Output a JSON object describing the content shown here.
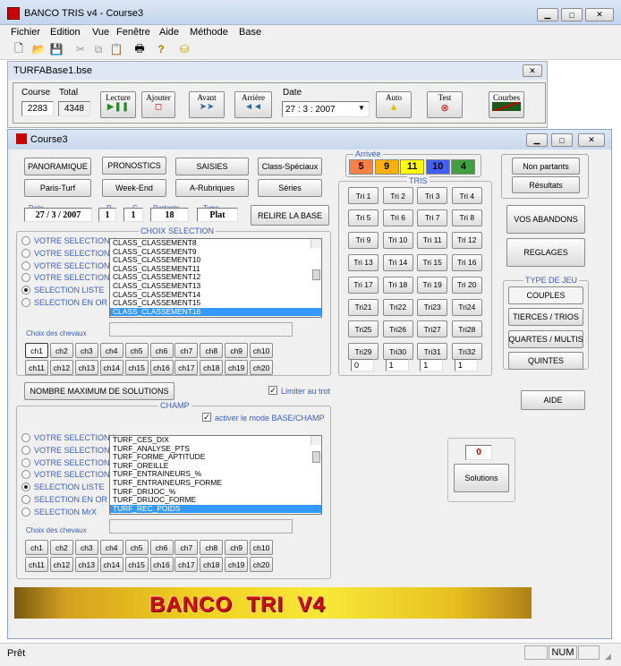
{
  "app": {
    "title": "BANCO TRIS v4 - Course3",
    "icon": "turf-icon"
  },
  "menu": [
    "Fichier",
    "Edition",
    "Vue",
    "Fenêtre",
    "Aide",
    "Méthode",
    "Base"
  ],
  "base_window": {
    "title": "TURFABase1.bse",
    "course_label": "Course",
    "course_value": "2283",
    "total_label": "Total",
    "total_value": "4348",
    "lecture": "Lecture",
    "ajouter": "Ajouter",
    "avant": "Avant",
    "arriere": "Arrière",
    "date_label": "Date",
    "date_value": "27 : 3 : 2007",
    "auto": "Auto",
    "test": "Test",
    "courbes": "Courbes"
  },
  "course_window": {
    "title": "Course3"
  },
  "nav_buttons": [
    "PANORAMIQUE",
    "PRONOSTICS",
    "SAISIES",
    "Class-Spéciaux",
    "Paris-Turf",
    "Week-End",
    "A-Rubriques",
    "Séries"
  ],
  "info": {
    "date_label": "Date",
    "date_value": "27 / 3 / 2007",
    "r_label": "R",
    "r_value": "1",
    "c_label": "C",
    "c_value": "1",
    "partants_label": "Partants",
    "partants_value": "18",
    "type_label": "Type",
    "type_value": "Plat",
    "relire": "RELIRE LA BASE"
  },
  "choix_selection": {
    "title": "CHOIX SELECTION",
    "options": [
      "VOTRE SELECTION 1",
      "VOTRE SELECTION 2",
      "VOTRE SELECTION 3",
      "VOTRE SELECTION 4",
      "SELECTION LISTE",
      "SELECTION EN OR"
    ],
    "selected_index": 4,
    "list": [
      "CLASS_CLASSEMENT8",
      "CLASS_CLASSEMENT9",
      "CLASS_CLASSEMENT10",
      "CLASS_CLASSEMENT11",
      "CLASS_CLASSEMENT12",
      "CLASS_CLASSEMENT13",
      "CLASS_CLASSEMENT14",
      "CLASS_CLASSEMENT15",
      "CLASS_CLASSEMENT16"
    ],
    "list_selected": 8,
    "choix_chevaux": "Choix des chevaux"
  },
  "horses": [
    "ch1",
    "ch2",
    "ch3",
    "ch4",
    "ch5",
    "ch6",
    "ch7",
    "ch8",
    "ch9",
    "ch10",
    "ch11",
    "ch12",
    "ch13",
    "ch14",
    "ch15",
    "ch16",
    "ch17",
    "ch18",
    "ch19",
    "ch20"
  ],
  "nombre_max": "NOMBRE MAXIMUM DE SOLUTIONS",
  "limiter": "Limiter au trot",
  "champ": {
    "title": "CHAMP",
    "activer": "activer le mode  BASE/CHAMP",
    "options": [
      "VOTRE SELECTION 1",
      "VOTRE SELECTION 2",
      "VOTRE SELECTION 3",
      "VOTRE SELECTION 4",
      "SELECTION LISTE",
      "SELECTION EN OR",
      "SELECTION MrX"
    ],
    "selected_index": 4,
    "list": [
      "TURF_CES_DIX",
      "TURF_ANALYSE_PTS",
      "TURF_FORME_APTITUDE",
      "TURF_OREILLE",
      "TURF_ENTRAINEURS_%",
      "TURF_ENTRAINEURS_FORME",
      "TURF_DRIJOC_%",
      "TURF_DRIJOC_FORME",
      "TURF_REC_POIDS"
    ],
    "list_selected": 8,
    "choix_chevaux": "Choix des chevaux"
  },
  "arrivee": {
    "title": "Arrivée",
    "values": [
      "5",
      "9",
      "11",
      "10",
      "4"
    ],
    "colors": [
      "#ff8040",
      "#ffb000",
      "#ffff00",
      "#4060ff",
      "#40a040"
    ]
  },
  "tris": {
    "title": "TRIS",
    "buttons": [
      "Tri 1",
      "Tri 2",
      "Tri 3",
      "Tri 4",
      "Tri 5",
      "Tri 6",
      "Tri 7",
      "Tri 8",
      "Tri 9",
      "Tri 10",
      "Tri 11",
      "Tri 12",
      "Tri 13",
      "Tri 14",
      "Tri 15",
      "Tri 16",
      "Tri 17",
      "Tri 18",
      "Tri 19",
      "Tri 20",
      "Tri21",
      "Tri22",
      "Tri23",
      "Tri24",
      "Tri25",
      "Tri26",
      "Tri27",
      "Tri28",
      "Tri29",
      "Tri30",
      "Tri31",
      "Tri32"
    ],
    "fields": [
      "0",
      "1",
      "1",
      "1"
    ]
  },
  "right": {
    "non_partants": "Non partants",
    "resultats": "Résultats",
    "abandons": "VOS ABANDONS",
    "reglages": "REGLAGES",
    "type_jeu_title": "TYPE DE JEU",
    "type_jeu": [
      "COUPLES",
      "TIERCES / TRIOS",
      "QUARTES / MULTIS",
      "QUINTES"
    ],
    "aide": "AIDE",
    "solutions_value": "0",
    "solutions": "Solutions"
  },
  "banner": "BANCO  TRI  V4",
  "status": {
    "text": "Prêt",
    "num": "NUM"
  }
}
